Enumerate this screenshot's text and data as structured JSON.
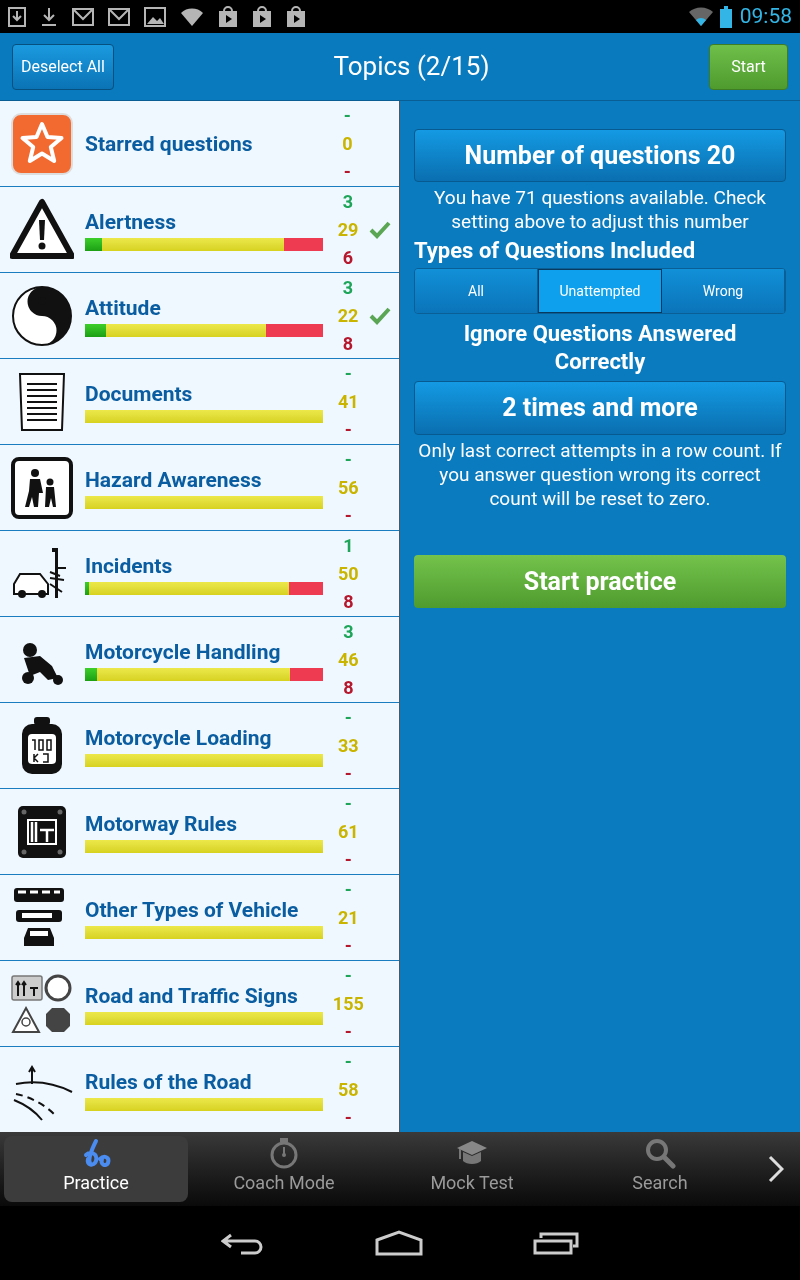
{
  "status_bar": {
    "time": "09:58"
  },
  "action_bar": {
    "left_button": "Deselect All",
    "title": "Topics (2/15)",
    "right_button": "Start"
  },
  "topics": [
    {
      "kind": "star",
      "name": "Starred questions",
      "correct": "-",
      "total": "0",
      "wrong": "-",
      "selected": false
    },
    {
      "kind": "warning",
      "name": "Alertness",
      "correct": "3",
      "total": "29",
      "wrong": "6",
      "selected": true,
      "bar": [
        {
          "kind": "correct",
          "level": 0.07
        },
        {
          "kind": "wrong",
          "level": 0.165
        }
      ]
    },
    {
      "kind": "yinyang",
      "name": "Attitude",
      "correct": "3",
      "total": "22",
      "wrong": "8",
      "selected": true,
      "bar": [
        {
          "kind": "correct",
          "level": 0.09
        },
        {
          "kind": "wrong",
          "level": 0.24
        }
      ]
    },
    {
      "kind": "document",
      "name": "Documents",
      "correct": "-",
      "total": "41",
      "wrong": "-",
      "selected": false
    },
    {
      "kind": "hazard",
      "name": "Hazard Awareness",
      "correct": "-",
      "total": "56",
      "wrong": "-",
      "selected": false
    },
    {
      "kind": "crash",
      "name": "Incidents",
      "correct": "1",
      "total": "50",
      "wrong": "8",
      "selected": false,
      "bar": [
        {
          "kind": "correct",
          "level": 0.015
        },
        {
          "kind": "wrong",
          "level": 0.145
        }
      ]
    },
    {
      "kind": "motorcycle",
      "name": "Motorcycle Handling",
      "correct": "3",
      "total": "46",
      "wrong": "8",
      "selected": false,
      "bar": [
        {
          "kind": "correct",
          "level": 0.05
        },
        {
          "kind": "wrong",
          "level": 0.14
        }
      ]
    },
    {
      "kind": "weight",
      "name": "Motorcycle Loading",
      "correct": "-",
      "total": "33",
      "wrong": "-",
      "selected": false
    },
    {
      "kind": "motorway",
      "name": "Motorway Rules",
      "correct": "-",
      "total": "61",
      "wrong": "-",
      "selected": false
    },
    {
      "kind": "vehicles",
      "name": "Other Types of Vehicle",
      "correct": "-",
      "total": "21",
      "wrong": "-",
      "selected": false
    },
    {
      "kind": "signs",
      "name": "Road and Traffic Signs",
      "correct": "-",
      "total": "155",
      "wrong": "-",
      "selected": false
    },
    {
      "kind": "road",
      "name": "Rules of the Road",
      "correct": "-",
      "total": "58",
      "wrong": "-",
      "selected": false
    }
  ],
  "settings": {
    "count_button": "Number of questions  20",
    "count_note": "You have 71 questions available. Check setting above to adjust this number",
    "types_heading": "Types of Questions Included",
    "types": [
      {
        "label": "All",
        "selected": false
      },
      {
        "label": "Unattempted",
        "selected": true
      },
      {
        "label": "Wrong",
        "selected": false
      }
    ],
    "ignore_heading": "Ignore Questions Answered Correctly",
    "ignore_button": "2 times and more",
    "ignore_note": "Only last correct attempts in a row count. If you answer question wrong its correct count will be reset to zero.",
    "start_button": "Start practice"
  },
  "tabs": [
    {
      "kind": "practice",
      "label": "Practice",
      "selected": true
    },
    {
      "kind": "stopwatch",
      "label": "Coach Mode",
      "selected": false
    },
    {
      "kind": "cap",
      "label": "Mock Test",
      "selected": false
    },
    {
      "kind": "search",
      "label": "Search",
      "selected": false
    }
  ]
}
